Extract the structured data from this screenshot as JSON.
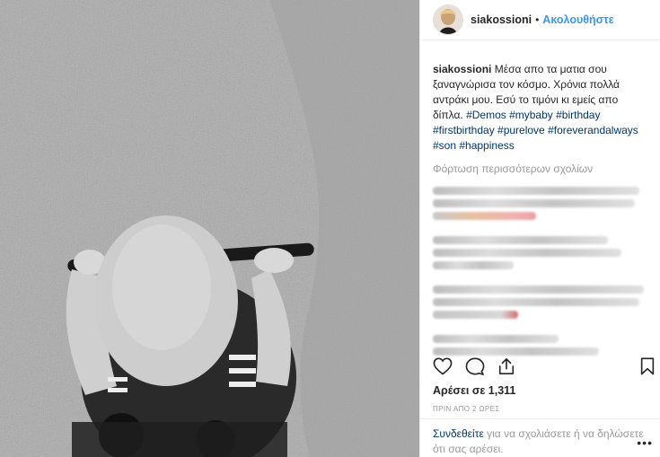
{
  "post": {
    "username": "siakossioni",
    "separator": "•",
    "follow_label": "Ακολουθήστε"
  },
  "caption": {
    "username": "siakossioni",
    "text": "Μέσα απο τα ματια σου ξαναγνώρισα τον κόσμο. Χρόνια πολλά αντράκι μου. Εσύ το τιμόνι κι εμείς απο δίπλα.",
    "hashtags_line1": "#Demos #mybaby #birthday",
    "hashtags_line2": "#firstbirthday #purelove #foreverandalways",
    "hashtags_line3": "#son #happiness"
  },
  "load_more_label": "Φόρτωση περισσότερων σχολίων",
  "likes_text": "Αρέσει σε 1,311",
  "time_text": "ΠΡΙΝ ΑΠΟ 2 ΩΡΕΣ",
  "footer": {
    "login_label": "Συνδεθείτε",
    "rest_text": "για να σχολιάσετε ή να δηλώσετε ότι σας αρέσει."
  },
  "more_label": "•••",
  "icons": {
    "like": "heart-icon",
    "comment": "comment-icon",
    "share": "share-icon",
    "save": "bookmark-icon"
  },
  "colors": {
    "link": "#3897f0",
    "hashtag": "#003569",
    "muted": "#999999"
  }
}
